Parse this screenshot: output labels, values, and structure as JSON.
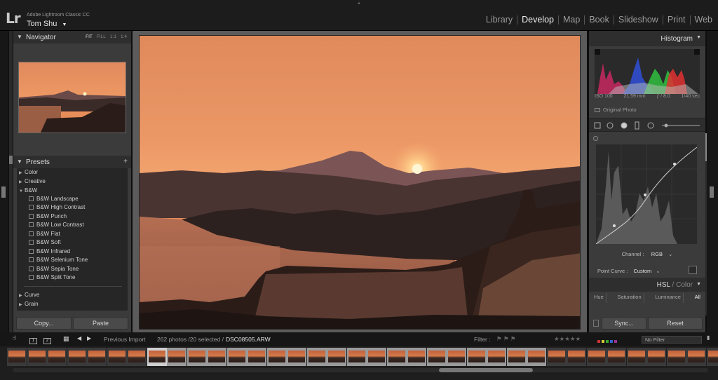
{
  "app": {
    "product_name": "Adobe Lightroom Classic CC",
    "logo_text": "Lr",
    "user_name": "Tom Shu",
    "user_caret": "▼"
  },
  "modules": [
    "Library",
    "Develop",
    "Map",
    "Book",
    "Slideshow",
    "Print",
    "Web"
  ],
  "active_module": "Develop",
  "navigator": {
    "title": "Navigator",
    "zoom_options": [
      "FIT",
      "FILL",
      "1:1",
      "1:4"
    ],
    "active_zoom": "FIT"
  },
  "presets": {
    "title": "Presets",
    "add": "+",
    "groups": [
      {
        "label": "Color",
        "expanded": false
      },
      {
        "label": "Creative",
        "expanded": false
      },
      {
        "label": "B&W",
        "expanded": true
      }
    ],
    "bw_items": [
      "B&W Landscape",
      "B&W High Contrast",
      "B&W Punch",
      "B&W Low Contrast",
      "B&W Flat",
      "B&W Soft",
      "B&W Infrared",
      "B&W Selenium Tone",
      "B&W Sepia Tone",
      "B&W Split Tone"
    ],
    "more_groups": [
      "Curve",
      "Grain"
    ]
  },
  "left_buttons": {
    "copy": "Copy...",
    "paste": "Paste"
  },
  "histogram": {
    "title": "Histogram",
    "iso": "ISO 100",
    "focal": "21.59 mm",
    "aperture": "ƒ / 8.0",
    "shutter": "1/40 sec",
    "original_photo": "Original Photo"
  },
  "tone_curve": {
    "channel_label": "Channel :",
    "channel_value": "RGB",
    "point_curve_label": "Point Curve :",
    "point_curve_value": "Custom"
  },
  "hsl": {
    "title_hsl": "HSL",
    "title_sep": " / ",
    "title_color": "Color",
    "tabs": [
      "Hue",
      "Saturation",
      "Luminance",
      "All"
    ]
  },
  "right_buttons": {
    "sync": "Sync...",
    "reset": "Reset"
  },
  "filmstrip": {
    "monitor_1": "1",
    "monitor_2": "2",
    "source": "Previous Import",
    "count": "262 photos /20 selected /",
    "filename": "DSC08505.ARW",
    "filter_label": "Filter :",
    "filter_value": "No Filter",
    "stars": "★★★★★",
    "thumb_count": 36,
    "selected_thumbs": [
      7,
      8,
      9,
      10,
      11,
      12,
      13,
      14,
      15,
      16,
      17,
      18,
      19,
      20,
      21,
      22,
      23,
      24,
      25,
      26
    ],
    "current_thumb": 7
  },
  "colors": {
    "accent_text": "#f0f0f0",
    "panel_bg": "#3b3b3b",
    "header_bg": "#2e2e2e",
    "sky_top": "#e88a5c",
    "sun": "#fff2c4"
  },
  "icons": [
    "triangle-down-icon",
    "triangle-right-icon",
    "grid-view-icon",
    "loupe-view-icon",
    "arrow-left-icon",
    "arrow-right-icon",
    "crop-tool-icon",
    "spot-removal-icon",
    "red-eye-icon",
    "graduated-filter-icon",
    "radial-filter-icon",
    "adjustment-brush-icon",
    "flag-icon",
    "color-label-icon"
  ]
}
